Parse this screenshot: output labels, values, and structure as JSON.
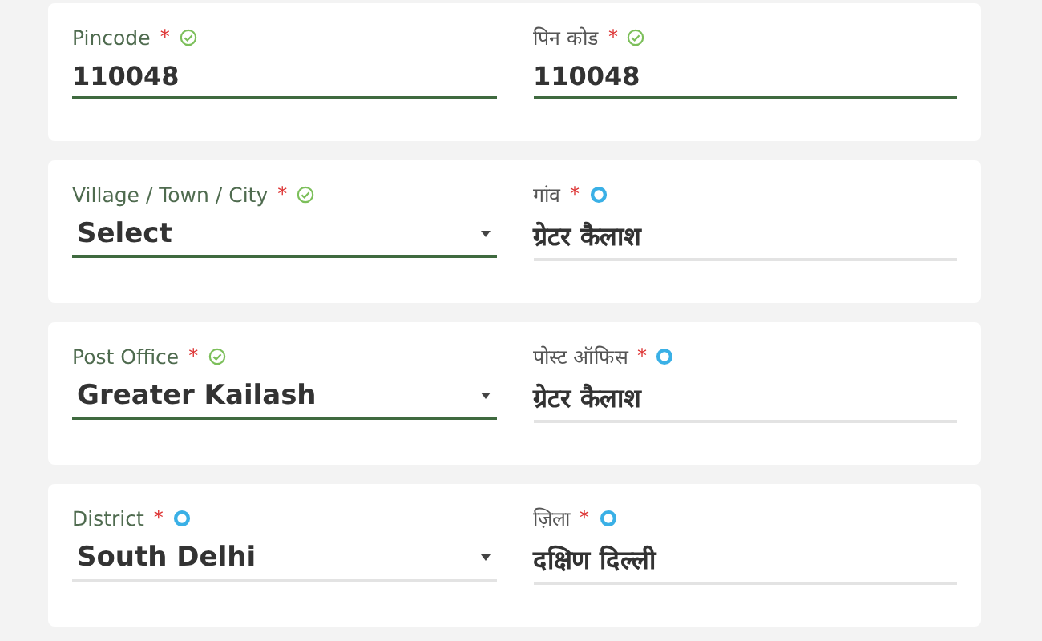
{
  "rows": [
    {
      "fields": [
        {
          "label": "Pincode",
          "required_mark": "*",
          "verified": true,
          "kind": "text",
          "value": "110048"
        },
        {
          "label": "पिन कोड",
          "required_mark": "*",
          "verified": true,
          "kind": "text",
          "value": "110048"
        }
      ]
    },
    {
      "fields": [
        {
          "label": "Village / Town / City",
          "required_mark": "*",
          "verified": true,
          "kind": "select",
          "value": "Select"
        },
        {
          "label": "गांव",
          "required_mark": "*",
          "verified": false,
          "kind": "text",
          "value": "ग्रेटर कैलाश"
        }
      ]
    },
    {
      "fields": [
        {
          "label": "Post Office",
          "required_mark": "*",
          "verified": true,
          "kind": "select",
          "value": "Greater Kailash"
        },
        {
          "label": "पोस्ट ऑफिस",
          "required_mark": "*",
          "verified": false,
          "kind": "text",
          "value": "ग्रेटर कैलाश"
        }
      ]
    },
    {
      "fields": [
        {
          "label": "District",
          "required_mark": "*",
          "verified": false,
          "kind": "select",
          "value": "South Delhi"
        },
        {
          "label": "ज़िला",
          "required_mark": "*",
          "verified": false,
          "kind": "text",
          "value": "दक्षिण दिल्ली"
        }
      ]
    }
  ]
}
